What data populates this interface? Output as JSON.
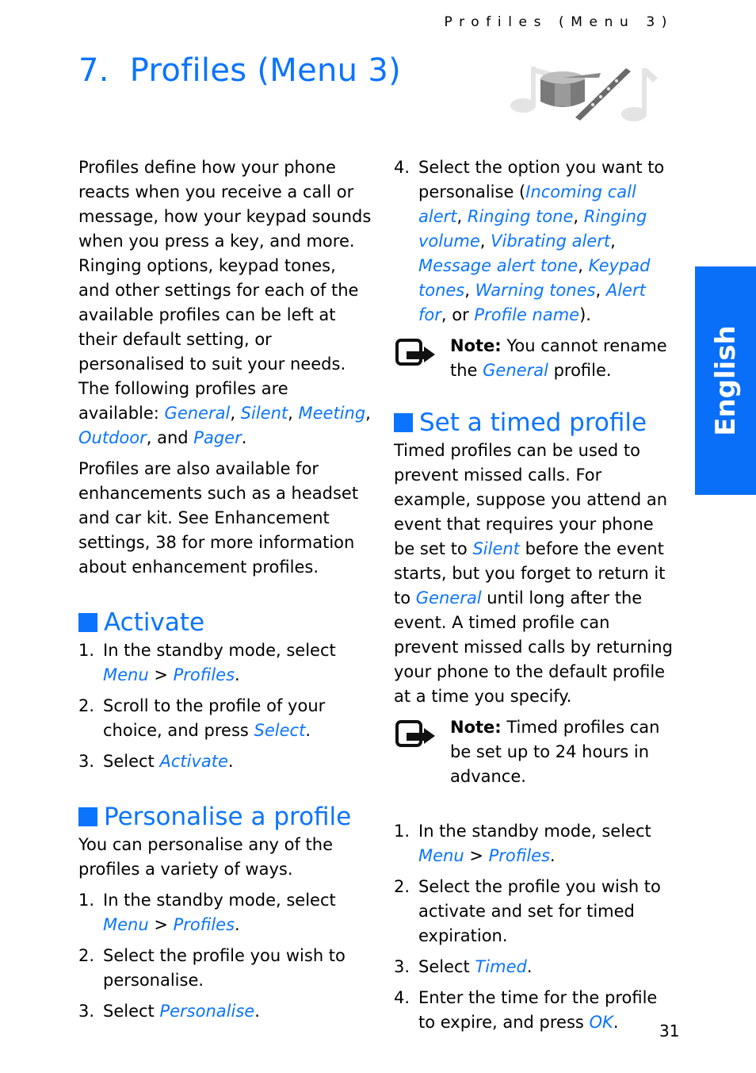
{
  "running_head": "Profiles (Menu 3)",
  "chapter": {
    "number": "7.",
    "title": "Profiles (Menu 3)"
  },
  "illustration": {
    "icon": "drum-and-flute-music-icon"
  },
  "language_tab": {
    "label": "English",
    "color": "#0a6ff8"
  },
  "accent_color": "#0a74ff",
  "page_number": "31",
  "left_column": {
    "intro_p1": {
      "text": "Profiles define how your phone reacts when you receive a call or message, how your keypad sounds when you press a key, and more. Ringing options, keypad tones, and other settings for each of the available profiles can be left at their default setting, or personalised to suit your needs. The following profiles are available: ",
      "links": [
        "General",
        "Silent",
        "Meeting",
        "Outdoor",
        "Pager"
      ],
      "sep1": ", ",
      "sep2": ", ",
      "sep3": ", ",
      "sep4": ", and ",
      "end": "."
    },
    "intro_p2": "Profiles are also available for enhancements such as a headset and car kit. See Enhancement settings, 38 for more information about enhancement profiles.",
    "activate": {
      "heading": "Activate",
      "steps": [
        {
          "num": "1.",
          "pre": "In the standby mode, select ",
          "link1": "Menu",
          "mid": " > ",
          "link2": "Profiles",
          "post": "."
        },
        {
          "num": "2.",
          "pre": "Scroll to the profile of your choice, and press ",
          "link1": "Select",
          "post": "."
        },
        {
          "num": "3.",
          "pre": "Select ",
          "link1": "Activate",
          "post": "."
        }
      ]
    },
    "personalise": {
      "heading": "Personalise a profile",
      "intro": "You can personalise any of the profiles a variety of ways.",
      "steps": [
        {
          "num": "1.",
          "pre": "In the standby mode, select ",
          "link1": "Menu",
          "mid": " > ",
          "link2": "Profiles",
          "post": "."
        },
        {
          "num": "2.",
          "pre": "Select the profile you wish to personalise."
        },
        {
          "num": "3.",
          "pre": "Select ",
          "link1": "Personalise",
          "post": "."
        }
      ]
    }
  },
  "right_column": {
    "step4": {
      "num": "4.",
      "pre": "Select the option you want to personalise (",
      "options": [
        "Incoming call alert",
        "Ringing tone",
        "Ringing volume",
        "Vibrating alert",
        "Message alert tone",
        "Keypad tones",
        "Warning tones",
        "Alert for",
        "Profile name"
      ],
      "comma": ", ",
      "or": ", or ",
      "post": ")."
    },
    "note1": {
      "label": "Note:",
      "pre": " You cannot rename the ",
      "link": "General",
      "post": " profile."
    },
    "timed": {
      "heading": "Set a timed profile",
      "body_pre": "Timed profiles can be used to prevent missed calls. For example, suppose you attend an event that requires your phone be set to ",
      "link1": "Silent",
      "body_mid": " before the event starts, but you forget to return it to ",
      "link2": "General",
      "body_post": " until long after the event. A timed profile can prevent missed calls by returning your phone to the default profile at a time you specify.",
      "note2": {
        "label": "Note:",
        "text": " Timed profiles can be set up to 24 hours in advance."
      },
      "steps": [
        {
          "num": "1.",
          "pre": "In the standby mode, select ",
          "link1": "Menu",
          "mid": " > ",
          "link2": "Profiles",
          "post": "."
        },
        {
          "num": "2.",
          "pre": "Select the profile you wish to activate and set for timed expiration."
        },
        {
          "num": "3.",
          "pre": "Select ",
          "link1": "Timed",
          "post": "."
        },
        {
          "num": "4.",
          "pre": "Enter the time for the profile to expire, and press ",
          "link1": "OK",
          "post": "."
        }
      ]
    }
  }
}
